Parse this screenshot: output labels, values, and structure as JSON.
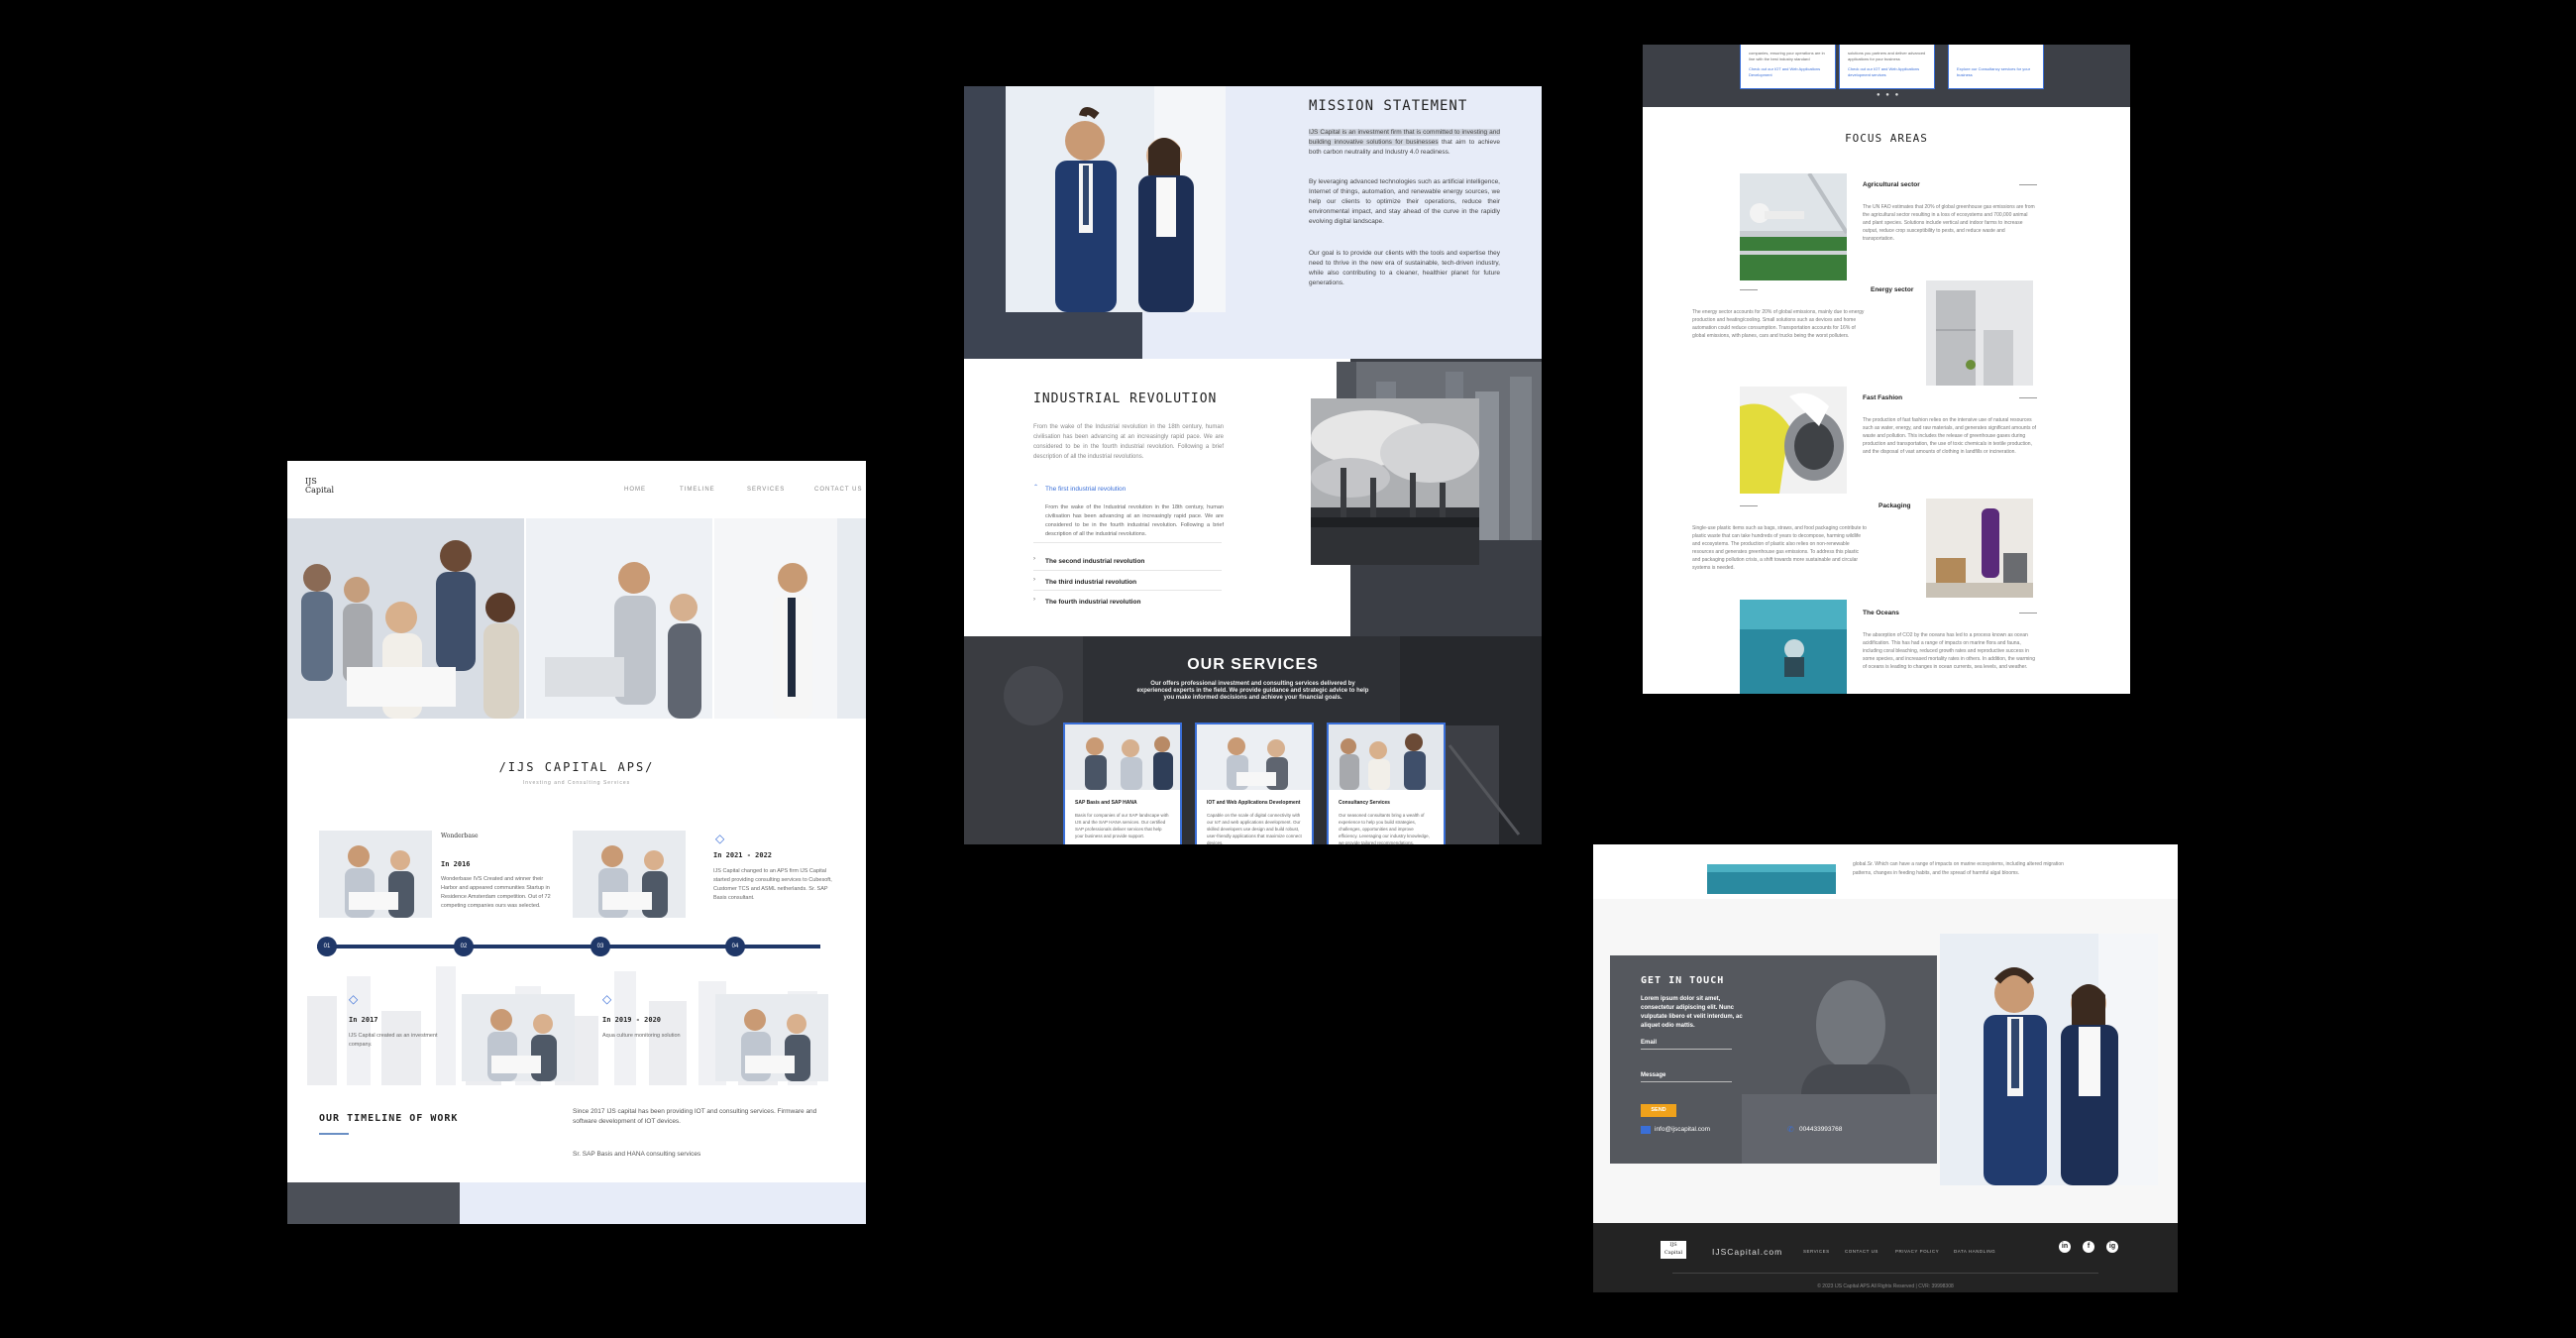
{
  "home": {
    "brand_line1": "IJS",
    "brand_line2": "Capital",
    "nav": [
      "HOME",
      "TIMELINE",
      "SERVICES",
      "CONTACT US"
    ],
    "title": "/IJS CAPITAL APS/",
    "subtitle": "Investing and Consulting Services",
    "timeline": [
      {
        "num": "01",
        "year": "In 2016",
        "text": "Wonderbase IVS Created and winner their Harbor and appeared communities Startup in Residence Amsterdam competition. Out of 72 competing companies ours was selected."
      },
      {
        "num": "02",
        "year": "In 2017",
        "text": "IJS Capital created as an investment company."
      },
      {
        "num": "03",
        "year": "In 2021 - 2022",
        "text": "IJS Capital changed to an APS firm IJS Capital started providing consulting services to Cubesoft, Customer TCS and ASML netherlands. Sr. SAP Basis consultant."
      },
      {
        "num": "04",
        "year": "In 2019 - 2020",
        "text": "Aqua culture monitoring solution"
      }
    ],
    "logo_text": "Wonderbase",
    "timeline_title": "OUR TIMELINE OF WORK",
    "timeline_desc1": "Since 2017 IJS capital has been providing IOT and consulting services. Firmware and software development of IOT devices.",
    "timeline_desc2": "Sr. SAP Basis and HANA consulting services"
  },
  "mission": {
    "title": "MISSION STATEMENT",
    "p1_highlight": "IJS Capital is an investment firm that is committed to investing and building innovative solutions for businesses",
    "p1_rest": " that aim to achieve both carbon neutrality and Industry 4.0 readiness.",
    "p2": "By leveraging advanced technologies such as artificial intelligence, Internet of things, automation, and renewable energy sources, we help our clients to optimize their operations, reduce their environmental impact, and stay ahead of the curve in the rapidly evolving digital landscape.",
    "p3": "Our goal is to provide our clients with the tools and expertise they need to thrive in the new era of sustainable, tech-driven industry, while also contributing to a cleaner, healthier planet for future generations.",
    "ir_title": "INDUSTRIAL REVOLUTION",
    "ir_intro": "From the wake of the Industrial revolution in the 18th century, human civilisation has been advancing at an increasingly rapid pace. We are considered to be in the fourth industrial revolution. Following a brief description of all the industrial revolutions.",
    "accordion": [
      {
        "label": "The first industrial revolution",
        "body": "From the wake of the Industrial revolution in the 18th century, human civilisation has been advancing at an increasingly rapid pace. We are considered to be in the fourth industrial revolution. Following a brief description of all the industrial revolutions."
      },
      {
        "label": "The second industrial revolution"
      },
      {
        "label": "The third industrial revolution"
      },
      {
        "label": "The fourth industrial revolution"
      }
    ],
    "services_title": "OUR SERVICES",
    "services_desc": "Our offers professional investment and consulting services delivered by experienced experts in the field. We provide guidance and strategic advice to help you make informed decisions and achieve your financial goals.",
    "cards": [
      {
        "title": "SAP Basis and SAP HANA",
        "text": "Basis for companies of our SAP landscape with IJS and the SAP HANA services. Our certified SAP professionals deliver services that help your business and provide support."
      },
      {
        "title": "IOT and Web Applications Development",
        "text": "Capable on the scale of digital connectivity with our IoT and web applications development. Our skilled developers use design and build robust, user-friendly applications that maximize connect devices."
      },
      {
        "title": "Consultancy Services",
        "text": "Our seasoned consultants bring a wealth of experience to help you build strategies, challenges, opportunities and improve efficiency. Leveraging our industry knowledge, we provide tailored recommendations."
      }
    ]
  },
  "focus": {
    "top_cards": [
      {
        "text": "companies, ensuring your operations are in line with the best industry standard",
        "link": "Check out our IOT and Web Applications Development"
      },
      {
        "text": "solutions you partners and deliver advanced applications for your business",
        "link": "Check out our IOT and Web Applications development services"
      },
      {
        "text": "",
        "link": "Explore our Consultancy services for your business"
      }
    ],
    "title": "FOCUS AREAS",
    "areas": [
      {
        "head": "Agricultural sector",
        "text": "The UN FAO estimates that 20% of global greenhouse gas emissions are from the agricultural sector resulting in a loss of ecosystems and 700,000 animal and plant species. Solutions include vertical and indoor farms to increase output, reduce crop susceptibility to pests, and reduce waste and transportation."
      },
      {
        "head": "Energy sector",
        "text": "The energy sector accounts for 20% of global emissions, mainly due to energy production and heating/cooling. Small solutions such as devices and home automation could reduce consumption. Transportation accounts for 16% of global emissions, with planes, cars and trucks being the worst polluters."
      },
      {
        "head": "Fast Fashion",
        "text": "The production of fast fashion relies on the intensive use of natural resources such as water, energy, and raw materials, and generates significant amounts of waste and pollution. This includes the release of greenhouse gases during production and transportation, the use of toxic chemicals in textile production, and the disposal of vast amounts of clothing in landfills or incineration."
      },
      {
        "head": "Packaging",
        "text": "Single-use plastic items such as bags, straws, and food packaging contribute to plastic waste that can take hundreds of years to decompose, harming wildlife and ecosystems. The production of plastic also relies on non-renewable resources and generates greenhouse gas emissions. To address this plastic and packaging pollution crisis, a shift towards more sustainable and circular systems is needed."
      },
      {
        "head": "The Oceans",
        "text": "The absorption of CO2 by the oceans has led to a process known as ocean acidification. This has had a range of impacts on marine flora and fauna, including coral bleaching, reduced growth rates and reproductive success in some species, and increased mortality rates in others. In addition, the warming of oceans is leading to changes in ocean currents, sea levels, and weather."
      }
    ]
  },
  "contact": {
    "top_text": "global.Sr. Which can have a range of impacts on marine ecosystems, including altered migration patterns, changes in feeding habits, and the spread of harmful algal blooms.",
    "title": "GET IN TOUCH",
    "desc": "Lorem ipsum dolor sit amet, consectetur adipiscing elit. Nunc vulputate libero et velit interdum, ac aliquet odio mattis.",
    "email_label": "Email",
    "message_label": "Message",
    "send_label": "SEND",
    "email": "info@ijscapital.com",
    "phone": "004433993768",
    "footer_brand": "IJSCapital.com",
    "footer_links": [
      "SERVICES",
      "CONTACT US",
      "PRIVACY POLICY",
      "DATA HANDLING"
    ],
    "social": [
      "in",
      "f",
      "ig"
    ],
    "copyright": "© 2023 IJS Capital APS All Rights Reserved | CVR: 39998308"
  }
}
